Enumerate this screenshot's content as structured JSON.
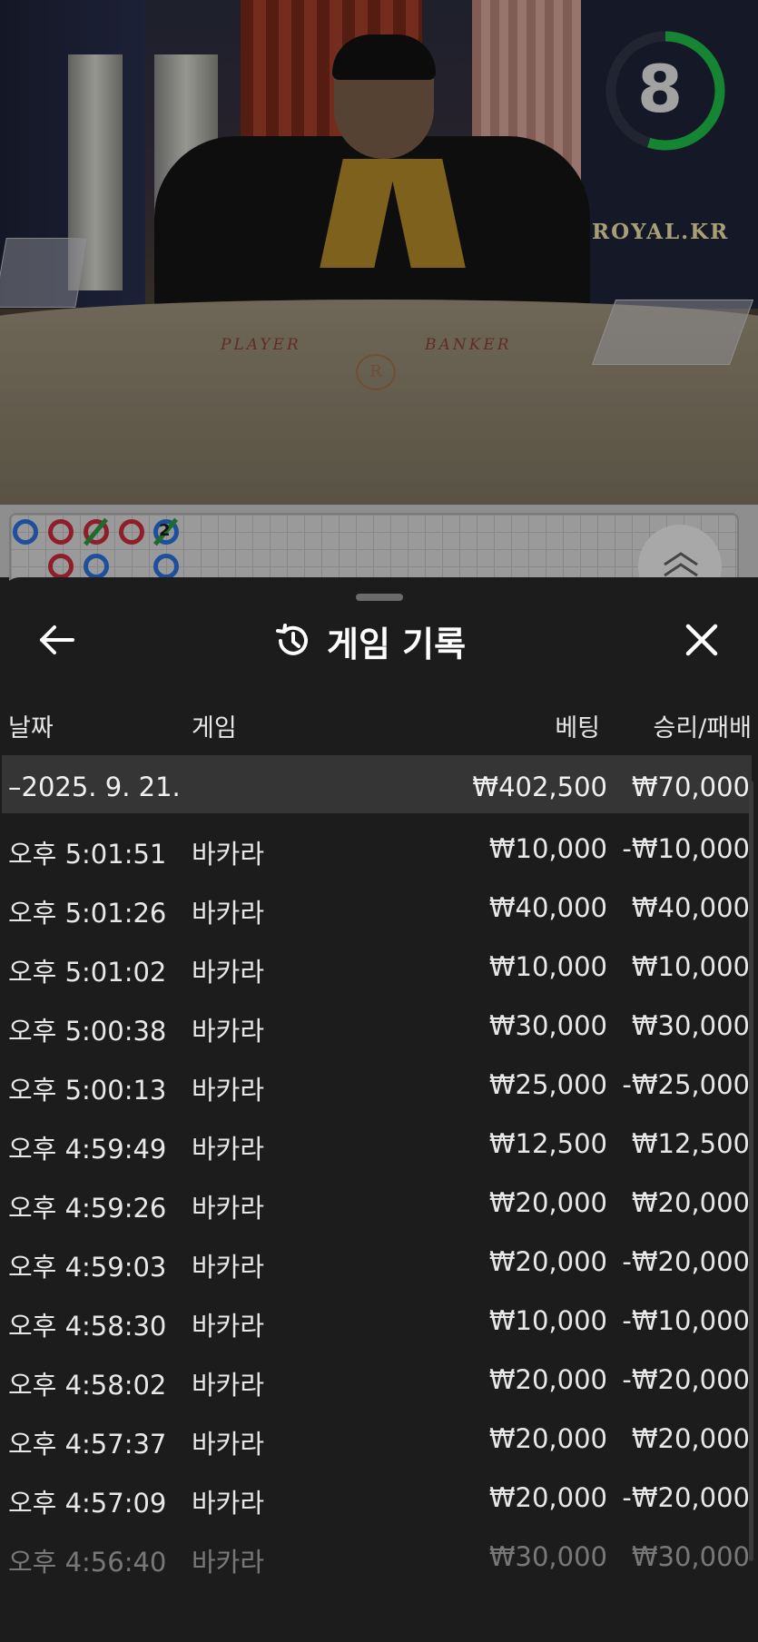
{
  "video": {
    "timer_value": "8",
    "timer_color": "#1fbf4a",
    "brand": "ROYAL.KR",
    "table_player_label": "PLAYER",
    "table_banker_label": "BANKER",
    "table_logo": "R"
  },
  "roadmap": {
    "bead_number": "2"
  },
  "panel": {
    "title": "게임 기록",
    "title_icon": "history-icon",
    "back_icon": "back-arrow-icon",
    "close_icon": "close-icon",
    "columns": {
      "date": "날짜",
      "game": "게임",
      "bet": "베팅",
      "result": "승리/패배"
    },
    "summary": {
      "date": "–2025. 9. 21.",
      "bet": "₩402,500",
      "result": "₩70,000"
    },
    "rows": [
      {
        "time": "오후 5:01:51",
        "game": "바카라",
        "bet": "₩10,000",
        "result": "-₩10,000"
      },
      {
        "time": "오후 5:01:26",
        "game": "바카라",
        "bet": "₩40,000",
        "result": "₩40,000"
      },
      {
        "time": "오후 5:01:02",
        "game": "바카라",
        "bet": "₩10,000",
        "result": "₩10,000"
      },
      {
        "time": "오후 5:00:38",
        "game": "바카라",
        "bet": "₩30,000",
        "result": "₩30,000"
      },
      {
        "time": "오후 5:00:13",
        "game": "바카라",
        "bet": "₩25,000",
        "result": "-₩25,000"
      },
      {
        "time": "오후 4:59:49",
        "game": "바카라",
        "bet": "₩12,500",
        "result": "₩12,500"
      },
      {
        "time": "오후 4:59:26",
        "game": "바카라",
        "bet": "₩20,000",
        "result": "₩20,000"
      },
      {
        "time": "오후 4:59:03",
        "game": "바카라",
        "bet": "₩20,000",
        "result": "-₩20,000"
      },
      {
        "time": "오후 4:58:30",
        "game": "바카라",
        "bet": "₩10,000",
        "result": "-₩10,000"
      },
      {
        "time": "오후 4:58:02",
        "game": "바카라",
        "bet": "₩20,000",
        "result": "-₩20,000"
      },
      {
        "time": "오후 4:57:37",
        "game": "바카라",
        "bet": "₩20,000",
        "result": "₩20,000"
      },
      {
        "time": "오후 4:57:09",
        "game": "바카라",
        "bet": "₩20,000",
        "result": "-₩20,000"
      },
      {
        "time": "오후 4:56:40",
        "game": "바카라",
        "bet": "₩30,000",
        "result": "₩30,000"
      }
    ]
  }
}
